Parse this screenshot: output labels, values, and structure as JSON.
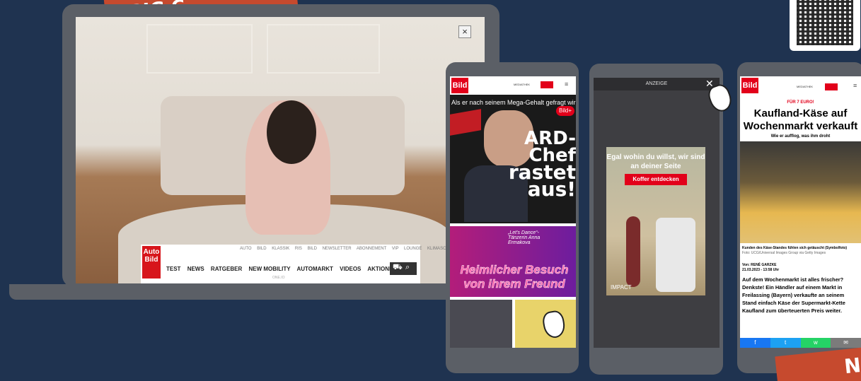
{
  "ribbons": {
    "top_left": "BIG C",
    "bottom_right": "N"
  },
  "laptop": {
    "close_symbol": "×",
    "autobild": {
      "logo": "Auto Bild",
      "top_links": "AUTO BILD KLASSIK RIS BILD NEWSLETTER ABONNEMENT VIP LOUNGE KLIMASCHUTZ",
      "nav": [
        "TEST",
        "NEWS",
        "RATGEBER",
        "NEW MOBILITY",
        "AUTOMARKT",
        "VIDEOS",
        "AKTIONEN"
      ],
      "footer": "ONE.IO"
    }
  },
  "phone1": {
    "logo": "Bild",
    "header_links": "MEDIATHEK",
    "teaser": "Als er nach seinem Mega-Gehalt gefragt wird",
    "headline": [
      "ARD-",
      "Chef",
      "rastet",
      "aus!"
    ],
    "badge": "Bild+",
    "story2_quote": "„Let’s Dance“-Tänzerin Anna Ermakova",
    "story2_headline": [
      "Heimlicher Besuch",
      "von ihrem Freund"
    ]
  },
  "phone2": {
    "ad_label": "ANZEIGE",
    "close_symbol": "✕",
    "ad_headline": "Egal wohin du willst, wir sind an deiner Seite",
    "ad_button": "Koffer entdecken",
    "ad_brand": "IMPACT"
  },
  "phone3": {
    "logo": "Bild",
    "header_links": "MEDIATHEK",
    "kicker": "FÜR 7 EURO!",
    "headline": "Kaufland-Käse auf Wochenmarkt verkauft",
    "subhead": "Wie er aufflog, was ihm droht",
    "caption": "Kunden des Käse-Standes fühlen sich getäuscht (Symbolfoto)",
    "credit": "Foto: UCG/Universal Images Group via Getty Images",
    "author": "Von: RENÉ GARZKE",
    "date": "21.03.2023 - 13:58 Uhr",
    "body": "Auf dem Wochenmarkt ist alles frischer? Denkste! Ein Händler auf einem Markt in Freilassing (Bayern) verkaufte an seinem Stand einfach Käse der Supermarkt-Kette Kaufland zum überteuerten Preis weiter.",
    "share": [
      "f",
      "t",
      "w",
      "✉"
    ]
  },
  "colors": {
    "background": "#1f3350",
    "device": "#5b5f66",
    "ribbon": "#c64a2e",
    "bild_red": "#e2001a"
  }
}
